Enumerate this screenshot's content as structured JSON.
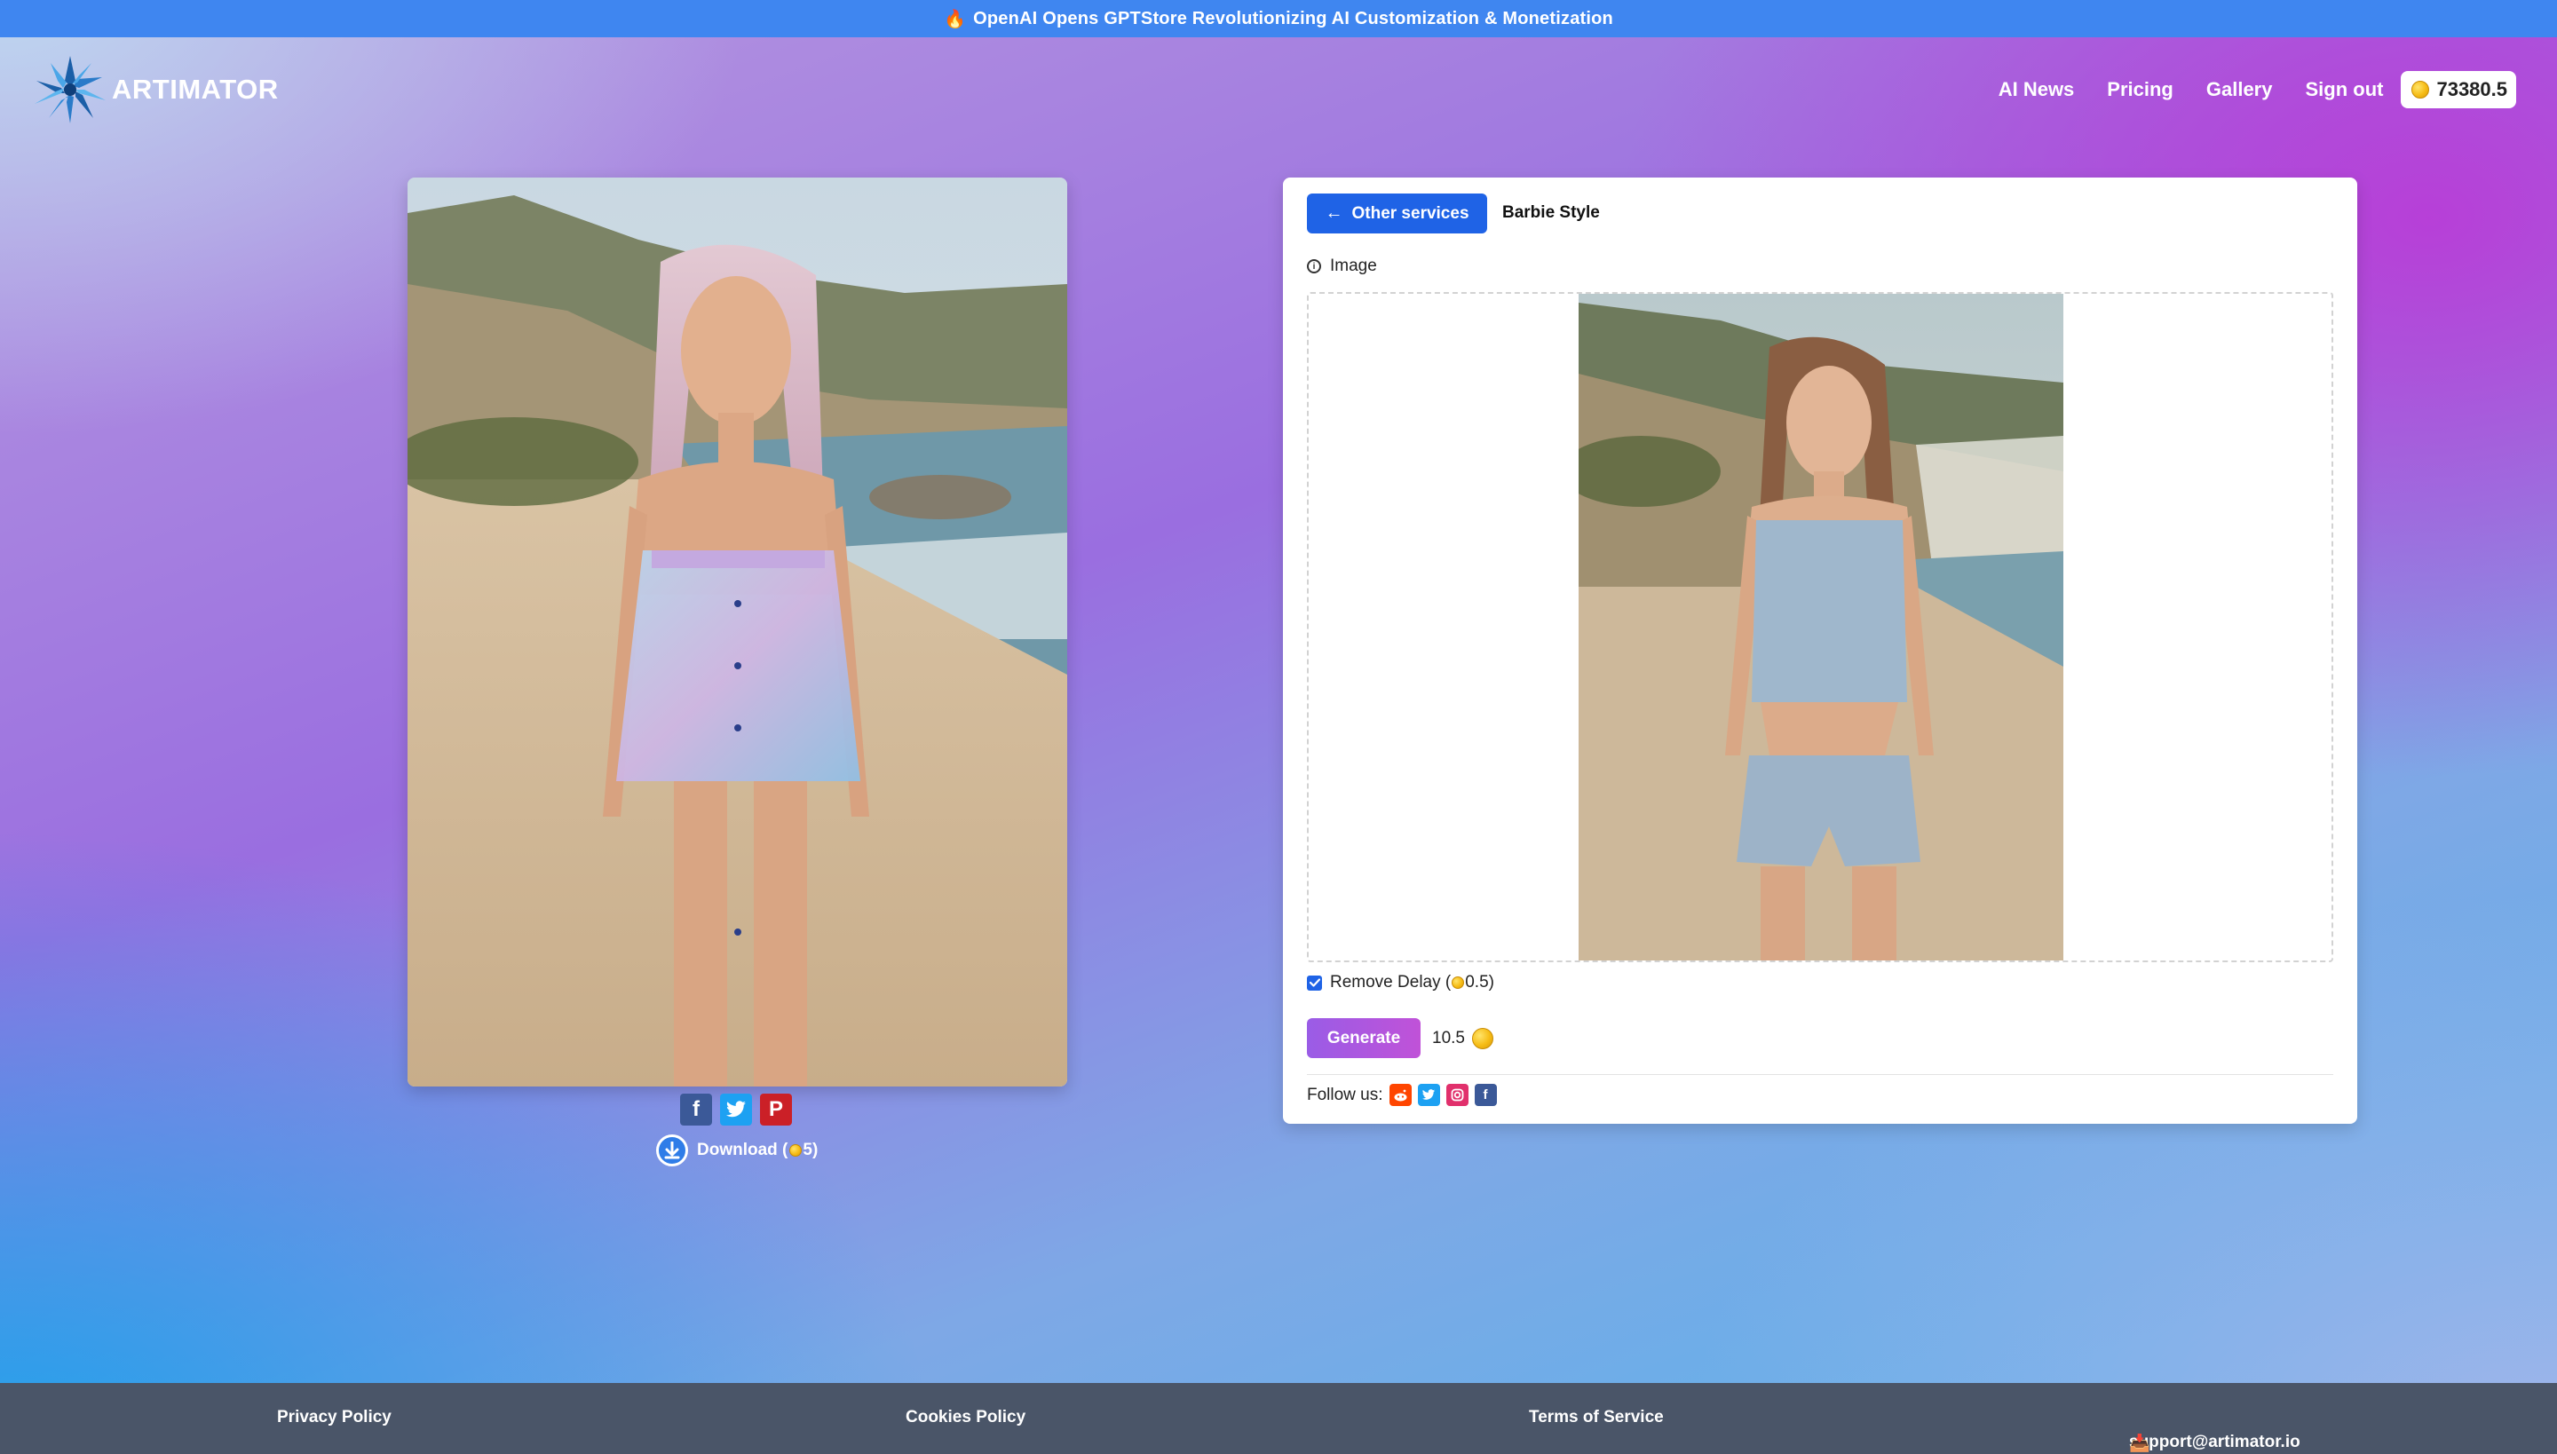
{
  "announcement": {
    "icon": "fire-icon",
    "text": "OpenAI Opens GPTStore Revolutionizing AI Customization & Monetization"
  },
  "header": {
    "brand": "ARTIMATOR",
    "nav": [
      "AI News",
      "Pricing",
      "Gallery",
      "Sign out"
    ],
    "credits": "73380.5"
  },
  "result": {
    "share": [
      "facebook-icon",
      "twitter-icon",
      "pinterest-icon"
    ],
    "download_label": "Download (",
    "download_cost": "5)"
  },
  "form": {
    "back_label": "Other services",
    "service_title": "Barbie Style",
    "image_label": "Image",
    "remove_delay_label": "Remove Delay (",
    "remove_delay_cost": "0.5)",
    "remove_delay_checked": true,
    "generate_label": "Generate",
    "total_cost": "10.5",
    "follow_label": "Follow us:",
    "social": [
      "reddit-icon",
      "twitter-icon",
      "instagram-icon",
      "facebook-icon"
    ]
  },
  "footer": {
    "privacy": "Privacy Policy",
    "cookies": "Cookies Policy",
    "terms": "Terms of Service",
    "support": "support@artimator.io"
  },
  "colors": {
    "announcement_bg": "#3f86f0",
    "primary_button": "#1f63e6",
    "generate_gradient": [
      "#9a5ce6",
      "#c052d8"
    ],
    "footer_bg": "#4a5568",
    "coin": "#f6bc15"
  }
}
